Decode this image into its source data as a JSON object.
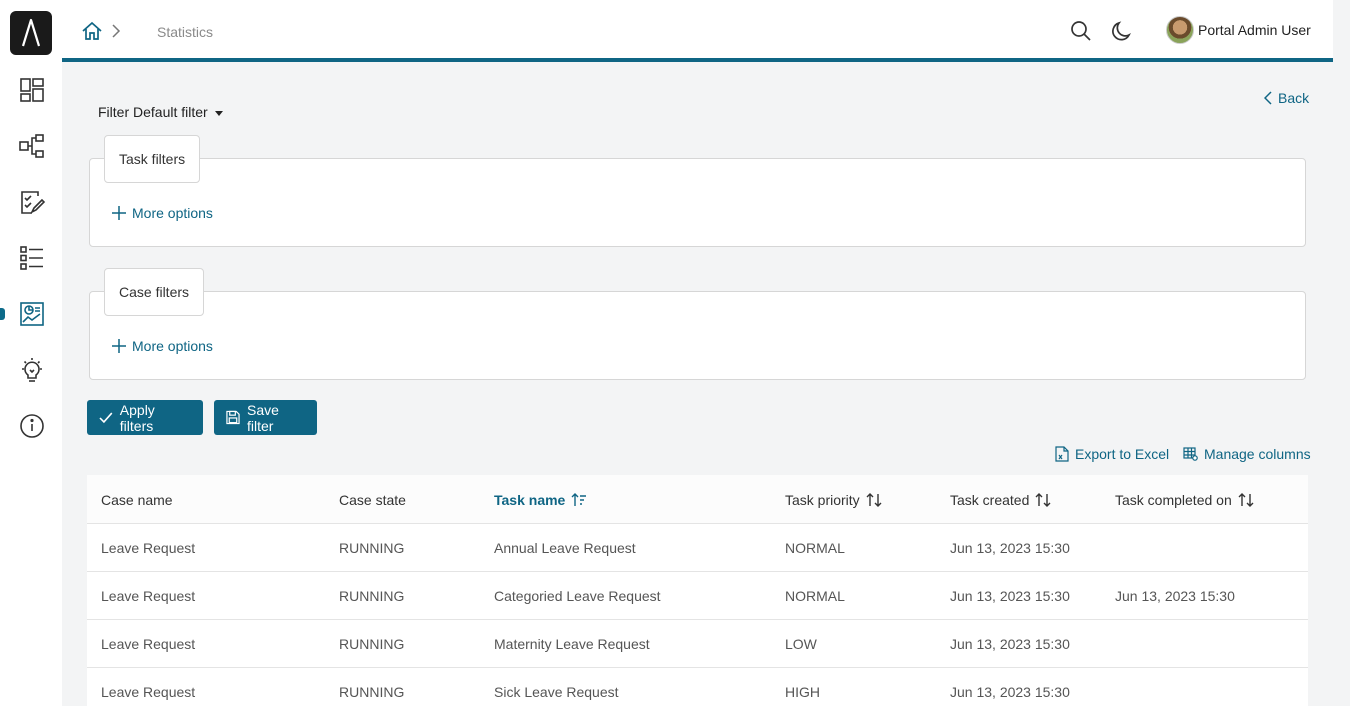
{
  "sidebar": {
    "items": [
      {
        "icon": "dashboard-icon"
      },
      {
        "icon": "process-icon"
      },
      {
        "icon": "tasks-icon"
      },
      {
        "icon": "list-icon"
      },
      {
        "icon": "statistics-icon"
      },
      {
        "icon": "idea-icon"
      },
      {
        "icon": "info-icon"
      }
    ],
    "active_index": 4,
    "accent_color": "#0f6584"
  },
  "header": {
    "breadcrumb": "Statistics",
    "user_name": "Portal Admin User"
  },
  "back_label": "Back",
  "filter": {
    "label": "Filter Default filter",
    "task_filters_label": "Task filters",
    "case_filters_label": "Case filters",
    "more_options_label": "More options"
  },
  "buttons": {
    "apply": "Apply filters",
    "save": "Save filter"
  },
  "tools": {
    "export": "Export to Excel",
    "manage": "Manage columns"
  },
  "table": {
    "columns": [
      "Case name",
      "Case state",
      "Task name",
      "Task priority",
      "Task created",
      "Task completed on"
    ],
    "sorted_column": "Task name",
    "rows": [
      [
        "Leave Request",
        "RUNNING",
        "Annual Leave Request",
        "NORMAL",
        "Jun 13, 2023 15:30",
        ""
      ],
      [
        "Leave Request",
        "RUNNING",
        "Categoried Leave Request",
        "NORMAL",
        "Jun 13, 2023 15:30",
        "Jun 13, 2023 15:30"
      ],
      [
        "Leave Request",
        "RUNNING",
        "Maternity Leave Request",
        "LOW",
        "Jun 13, 2023 15:30",
        ""
      ],
      [
        "Leave Request",
        "RUNNING",
        "Sick Leave Request",
        "HIGH",
        "Jun 13, 2023 15:30",
        ""
      ]
    ]
  }
}
